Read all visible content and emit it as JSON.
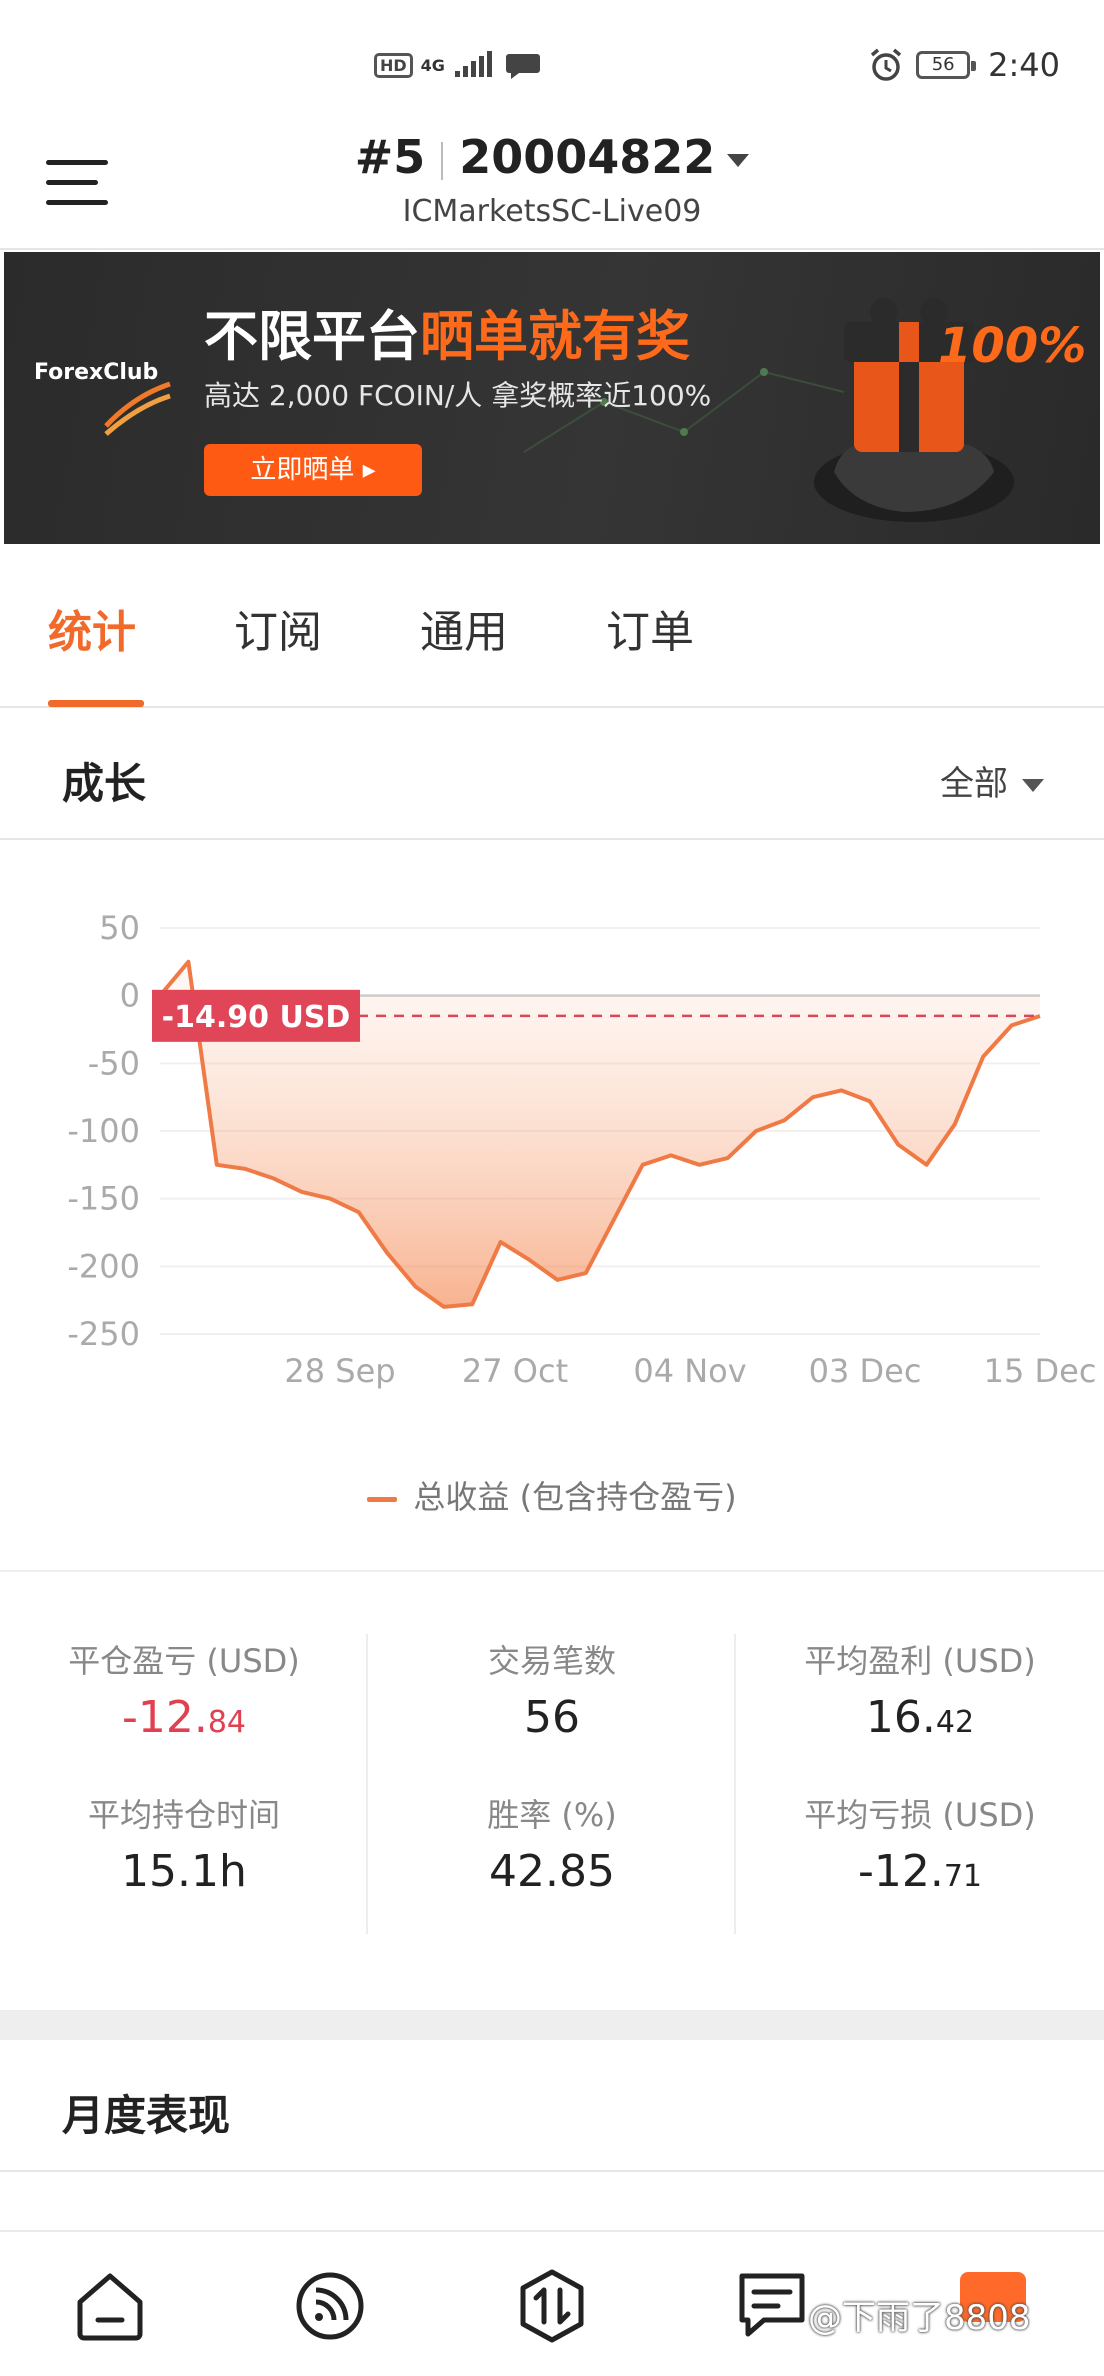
{
  "status_bar": {
    "left_badges": [
      "HD",
      "4G"
    ],
    "battery": "56",
    "time": "2:40"
  },
  "header": {
    "account_index": "#5",
    "account_number": "20004822",
    "server": "ICMarketsSC-Live09"
  },
  "banner": {
    "brand": "ForexClub",
    "headline_plain": "不限平台",
    "headline_highlight": "晒单就有奖",
    "subline": "高达 2,000 FCOIN/人  拿奖概率近100%",
    "cta_label": "立即晒单 ▸",
    "percent": "100%",
    "accent_color": "#ff6a1a"
  },
  "tabs": [
    {
      "label": "统计",
      "active": true
    },
    {
      "label": "订阅",
      "active": false
    },
    {
      "label": "通用",
      "active": false
    },
    {
      "label": "订单",
      "active": false
    }
  ],
  "growth": {
    "title": "成长",
    "filter_label": "全部"
  },
  "chart_data": {
    "type": "area",
    "x_tick_labels": [
      "28 Sep",
      "27 Oct",
      "04 Nov",
      "03 Dec",
      "15 Dec"
    ],
    "y_ticks": [
      50,
      0,
      -50,
      -100,
      -150,
      -200,
      -250
    ],
    "ylim": [
      -250,
      50
    ],
    "current_value_label": "-14.90 USD",
    "current_value": -14.9,
    "series": [
      {
        "name": "总收益 (包含持仓盈亏)",
        "color": "#f07a45",
        "values": [
          0,
          25,
          -125,
          -128,
          -135,
          -145,
          -150,
          -160,
          -190,
          -215,
          -230,
          -228,
          -182,
          -195,
          -210,
          -205,
          -165,
          -125,
          -118,
          -125,
          -120,
          -100,
          -92,
          -75,
          -70,
          -78,
          -110,
          -125,
          -95,
          -45,
          -22,
          -15
        ]
      }
    ],
    "legend": "总收益 (包含持仓盈亏)",
    "grid": true
  },
  "stats": [
    {
      "label": "平仓盈亏 (USD)",
      "int": "-12.",
      "dec": "84",
      "negative": true
    },
    {
      "label": "交易笔数",
      "int": "56",
      "dec": "",
      "negative": false
    },
    {
      "label": "平均盈利 (USD)",
      "int": "16.",
      "dec": "42",
      "negative": false
    },
    {
      "label": "平均持仓时间",
      "int": "15.1h",
      "dec": "",
      "negative": false
    },
    {
      "label": "胜率 (%)",
      "int": "42.85",
      "dec": "",
      "negative": false
    },
    {
      "label": "平均亏损 (USD)",
      "int": "-12.",
      "dec": "71",
      "negative": false
    }
  ],
  "monthly": {
    "title": "月度表现"
  },
  "bottom_nav": {
    "items": [
      "home-icon",
      "feed-icon",
      "trade-icon",
      "notes-icon",
      "calendar-icon"
    ],
    "watermark": "@下雨了8808"
  }
}
